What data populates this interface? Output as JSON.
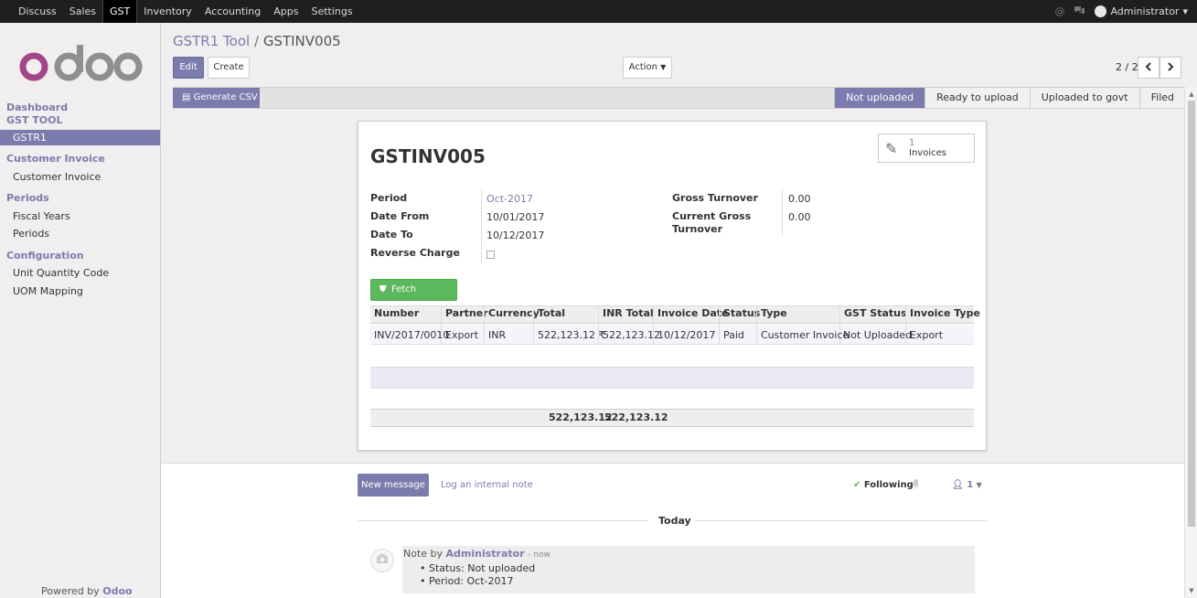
{
  "topbar": {
    "menu": [
      "Discuss",
      "Sales",
      "GST",
      "Inventory",
      "Accounting",
      "Apps",
      "Settings"
    ],
    "active": "GST",
    "user": "Administrator"
  },
  "sidebar": {
    "logo": "odoo",
    "sections": {
      "dashboard": "Dashboard",
      "gst_tool": "GST TOOL",
      "gstr1": "GSTR1",
      "customer_invoice_head": "Customer Invoice",
      "customer_invoice_item": "Customer Invoice",
      "periods_head": "Periods",
      "fiscal_years": "Fiscal Years",
      "periods_item": "Periods",
      "configuration": "Configuration",
      "unit_quantity_code": "Unit Quantity Code",
      "uom_mapping": "UOM Mapping"
    },
    "powered_by": "Powered by",
    "powered_brand": "Odoo"
  },
  "breadcrumb": {
    "parent": "GSTR1 Tool",
    "separator": "/",
    "current": "GSTINV005"
  },
  "toolbar": {
    "edit": "Edit",
    "create": "Create",
    "action": "Action",
    "pager": "2 / 2"
  },
  "statusbar": {
    "generate_csv": "Generate CSV",
    "stages": [
      "Not uploaded",
      "Ready to upload",
      "Uploaded to govt",
      "Filed"
    ],
    "active_stage": "Not uploaded"
  },
  "form": {
    "title": "GSTINV005",
    "smart_button": {
      "count": "1",
      "label": "Invoices"
    },
    "fields": {
      "period_label": "Period",
      "period_value": "Oct-2017",
      "date_from_label": "Date From",
      "date_from_value": "10/01/2017",
      "date_to_label": "Date To",
      "date_to_value": "10/12/2017",
      "reverse_charge_label": "Reverse Charge",
      "gross_turnover_label": "Gross Turnover",
      "gross_turnover_value": "0.00",
      "current_gross_label_1": "Current Gross",
      "current_gross_label_2": "Turnover",
      "current_gross_value": "0.00"
    },
    "fetch_button": "Fetch Invoices"
  },
  "table": {
    "columns": [
      "Number",
      "Partner",
      "Currency",
      "Total",
      "INR Total",
      "Invoice Date",
      "Status",
      "Type",
      "GST Status",
      "Invoice Type"
    ],
    "rows": [
      [
        "INV/2017/0010",
        "Export",
        "INR",
        "522,123.12 ₹",
        "522,123.12",
        "10/12/2017",
        "Paid",
        "Customer Invoice",
        "Not Uploaded",
        "Export"
      ]
    ],
    "footer": {
      "total": "522,123.12",
      "inr_total": "522,123.12"
    }
  },
  "chatter": {
    "new_message": "New message",
    "log_note": "Log an internal note",
    "following": "Following",
    "followers_count": "1",
    "today": "Today",
    "message": {
      "prefix": "Note by",
      "author": "Administrator",
      "time": "- now",
      "items": [
        "Status: Not uploaded",
        "Period: Oct-2017"
      ]
    }
  },
  "colors": {
    "brand": "#7c7bad",
    "success": "#5cb85c",
    "topbar": "#1f1f1f"
  }
}
